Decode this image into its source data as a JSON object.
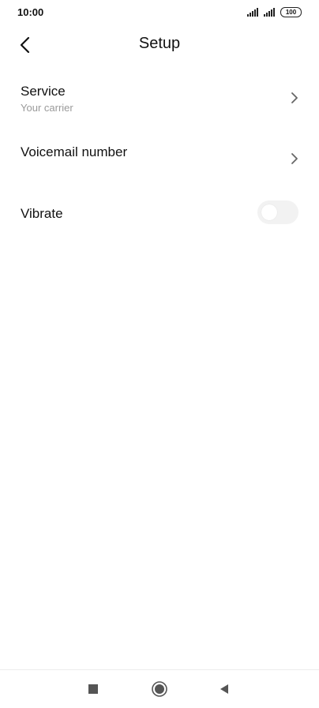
{
  "status_bar": {
    "time": "10:00",
    "battery": "100"
  },
  "header": {
    "title": "Setup"
  },
  "settings": {
    "service": {
      "title": "Service",
      "subtitle": "Your carrier"
    },
    "voicemail": {
      "title": "Voicemail number"
    },
    "vibrate": {
      "title": "Vibrate",
      "enabled": false
    }
  },
  "navigation": {
    "buttons": [
      "recents",
      "home",
      "back"
    ]
  },
  "colors": {
    "background": "#ffffff",
    "text_primary": "#111111",
    "text_secondary": "#9a9a9a",
    "toggle_off": "#f2f2f2",
    "chevron": "#666666",
    "nav_icons": "#555555"
  }
}
